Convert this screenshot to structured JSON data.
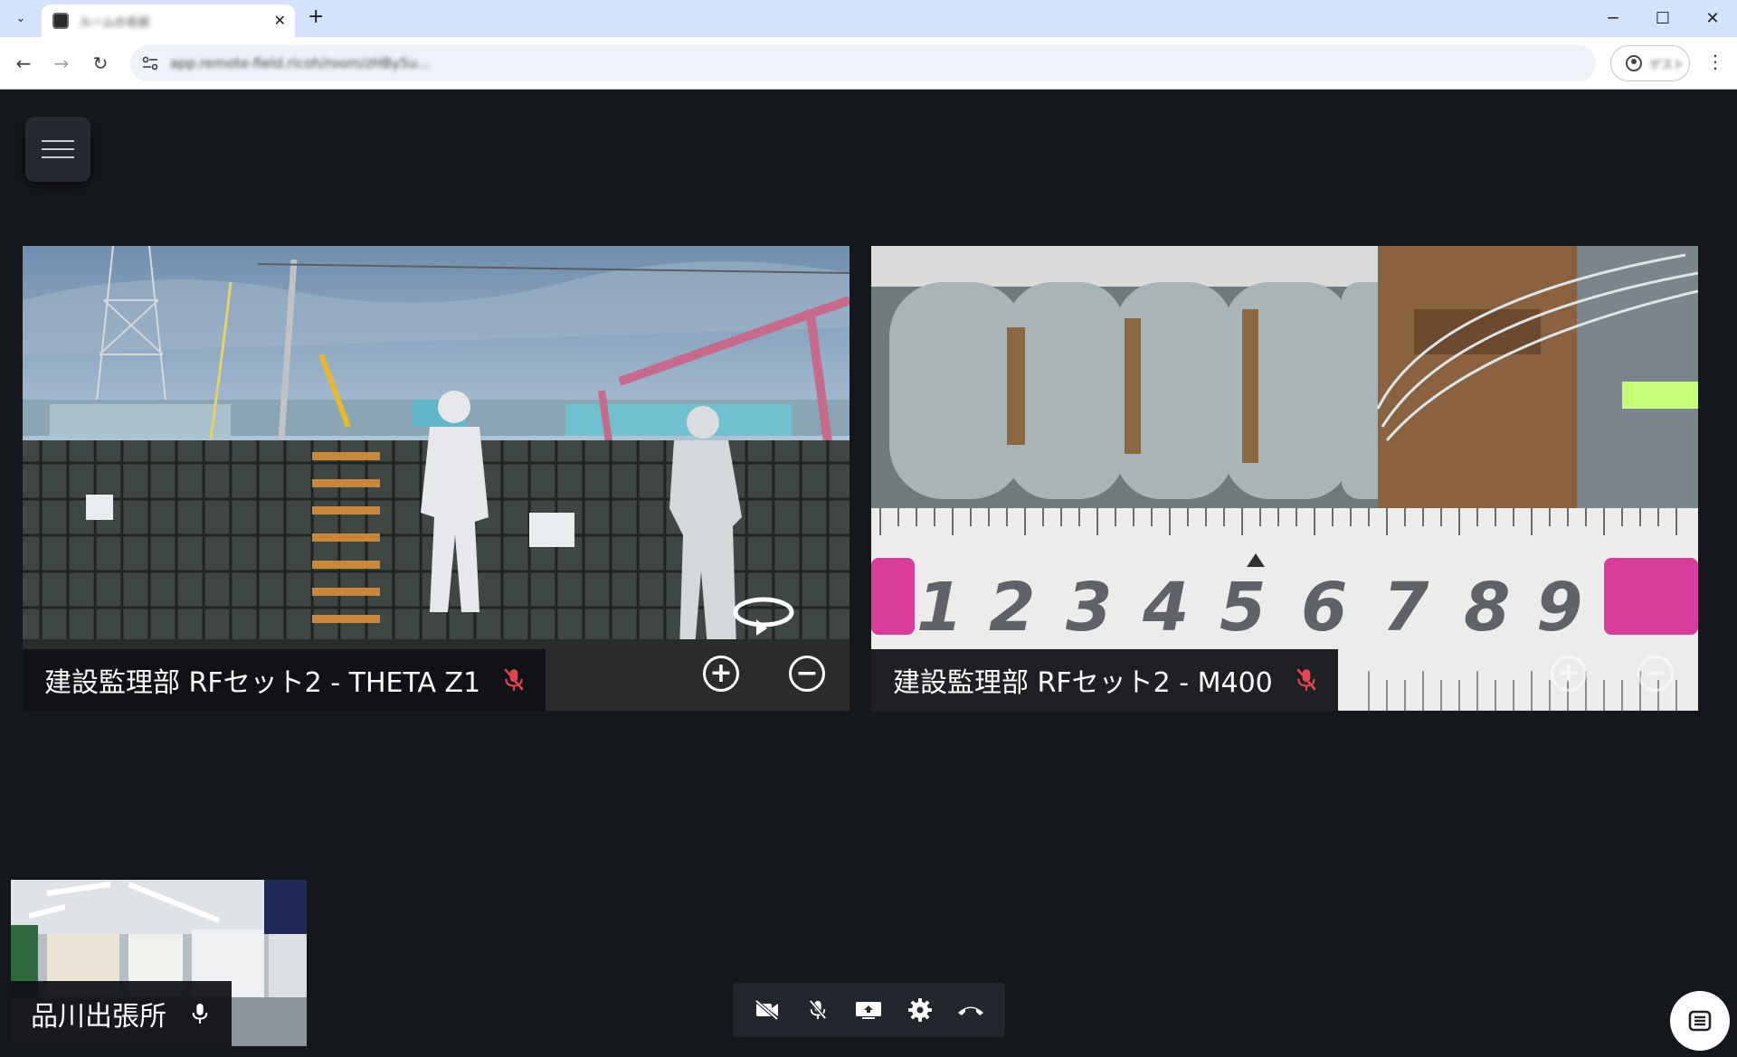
{
  "browser": {
    "tab_title": "ルームの名前",
    "url": "app.remote-field.ricoh/room/zHBy5u...",
    "profile_label": "ゲスト",
    "icons": [
      "tab-list-icon",
      "favicon-icon",
      "close-icon",
      "plus-icon",
      "minimize-icon",
      "maximize-icon",
      "close-window-icon",
      "back-icon",
      "forward-icon",
      "reload-icon",
      "site-info-icon",
      "profile-icon",
      "kebab-menu-icon"
    ]
  },
  "app": {
    "menu_icon": "hamburger-icon",
    "tiles": [
      {
        "name": "建設監理部 RFセット2 - THETA Z1",
        "mic": "mic-off",
        "controls": [
          "rotate-360-icon",
          "zoom-in-icon",
          "zoom-out-icon"
        ]
      },
      {
        "name": "建設監理部 RFセット2 - M400",
        "mic": "mic-off",
        "controls": [
          "zoom-in-icon",
          "zoom-out-icon"
        ]
      }
    ],
    "self_view": {
      "name": "品川出張所",
      "mic": "mic-on"
    },
    "controls": [
      "camera-off-icon",
      "mic-off-icon",
      "screen-share-icon",
      "settings-icon",
      "hang-up-icon"
    ],
    "chat_icon": "chat-list-icon"
  },
  "colors": {
    "app_bg": "#14171c",
    "mic_off": "#e2454f",
    "tabstrip": "#d3e3fd"
  }
}
